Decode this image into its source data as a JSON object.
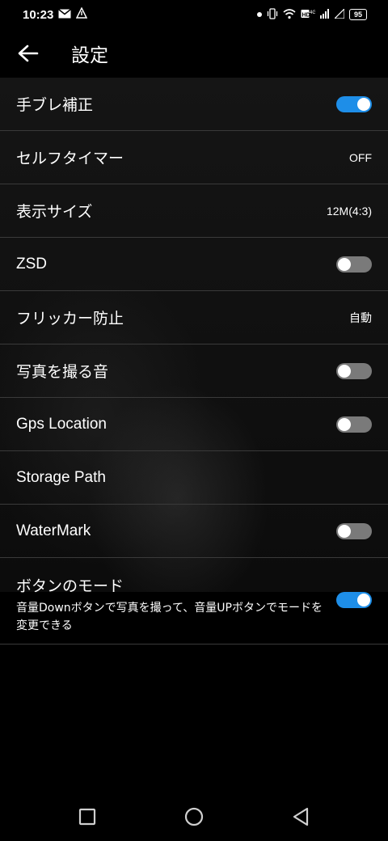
{
  "status": {
    "time": "10:23",
    "battery": "95",
    "icons": [
      "mail-icon",
      "alert-icon",
      "dot-icon",
      "vibrate-icon",
      "wifi-icon",
      "hd-icon",
      "signal-icon",
      "signal-icon",
      "battery-icon"
    ]
  },
  "header": {
    "title": "設定"
  },
  "settings": [
    {
      "label": "手ブレ補正",
      "type": "toggle",
      "state": "on"
    },
    {
      "label": "セルフタイマー",
      "type": "value",
      "value": "OFF"
    },
    {
      "label": "表示サイズ",
      "type": "value",
      "value": "12M(4:3)"
    },
    {
      "label": "ZSD",
      "type": "toggle",
      "state": "off"
    },
    {
      "label": "フリッカー防止",
      "type": "value",
      "value": "自動"
    },
    {
      "label": "写真を撮る音",
      "type": "toggle",
      "state": "off"
    },
    {
      "label": "Gps Location",
      "type": "toggle",
      "state": "off"
    },
    {
      "label": "Storage Path",
      "type": "none"
    },
    {
      "label": "WaterMark",
      "type": "toggle",
      "state": "off"
    },
    {
      "label": "ボタンのモード",
      "type": "toggle",
      "state": "on",
      "description": "音量Downボタンで写真を撮って、音量UPボタンでモードを変更できる"
    }
  ],
  "nav": [
    "recents-icon",
    "home-icon",
    "back-icon"
  ],
  "colors": {
    "accent": "#1e8ee8",
    "toggle_off": "#7a7a7a",
    "divider": "#3a3a3a"
  }
}
